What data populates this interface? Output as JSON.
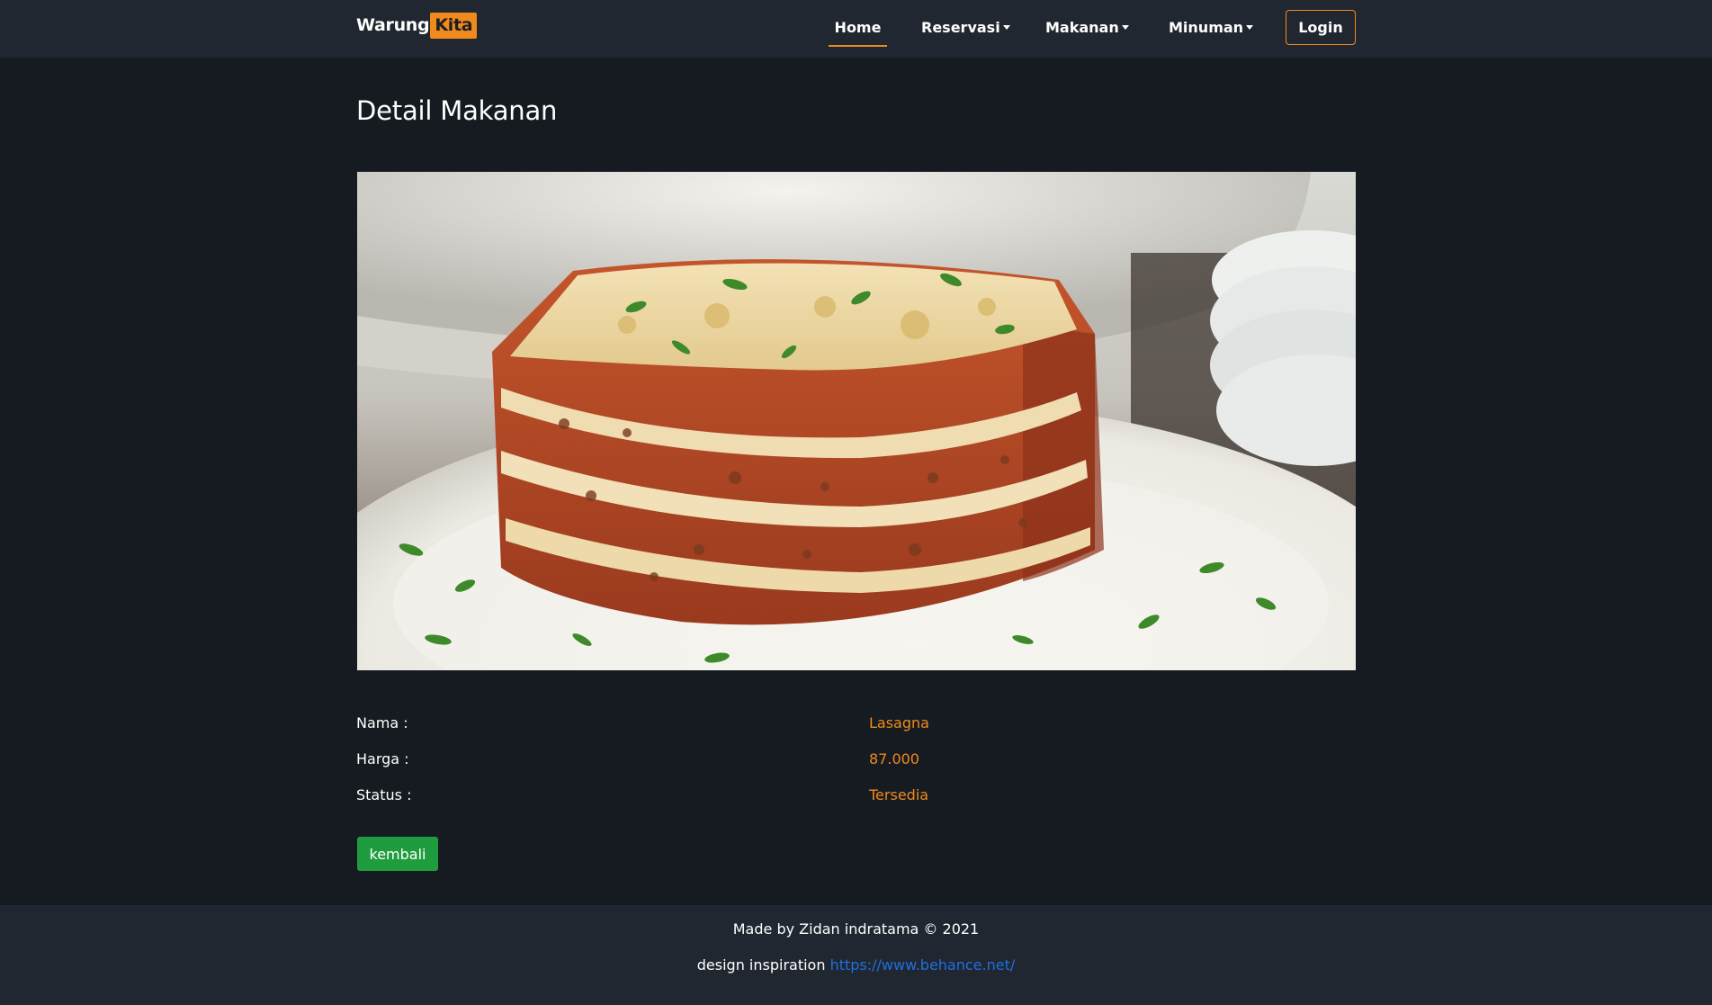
{
  "navbar": {
    "brand": {
      "part1": "Warung",
      "part2": "Kita"
    },
    "items": [
      {
        "label": "Home",
        "active": true,
        "dropdown": false
      },
      {
        "label": "Reservasi",
        "active": false,
        "dropdown": true
      },
      {
        "label": "Makanan",
        "active": false,
        "dropdown": true
      },
      {
        "label": "Minuman",
        "active": false,
        "dropdown": true
      }
    ],
    "login_label": "Login"
  },
  "main": {
    "title": "Detail Makanan",
    "image_subject": "lasagna",
    "details": [
      {
        "label": "Nama :",
        "value": "Lasagna"
      },
      {
        "label": "Harga :",
        "value": "87.000"
      },
      {
        "label": "Status :",
        "value": "Tersedia"
      }
    ],
    "back_label": "kembali"
  },
  "footer": {
    "credit": "Made by Zidan indratama © 2021",
    "inspiration_text": "design inspiration",
    "inspiration_link": "https://www.behance.net/"
  },
  "colors": {
    "page_bg": "#161b21",
    "navbar_bg": "#202730",
    "accent": "#f08a1c",
    "back_button": "#1f9d3e",
    "link": "#1f6fe0"
  }
}
